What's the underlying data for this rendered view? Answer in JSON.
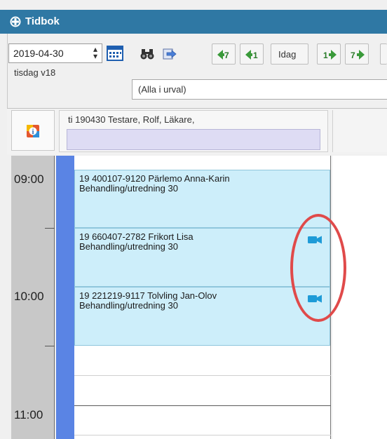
{
  "window": {
    "title": "Tidbok"
  },
  "toolbar": {
    "date_value": "2019-04-30",
    "weekday_label": "tisdag v18",
    "today_label": "Idag",
    "filter_value": "(Alla i urval)"
  },
  "header": {
    "column_label": "ti 190430 Testare, Rolf, Läkare,"
  },
  "timeline": {
    "hours": [
      "09:00",
      "10:00",
      "11:00"
    ]
  },
  "appointments": [
    {
      "line1": "19 400107-9120  Pärlemo Anna-Karin",
      "line2": "Behandling/utredning 30",
      "video": false
    },
    {
      "line1": "19 660407-2782  Frikort Lisa",
      "line2": "Behandling/utredning 30",
      "video": true
    },
    {
      "line1": "19 221219-9117  Tolvling Jan-Olov",
      "line2": "Behandling/utredning 30",
      "video": true
    }
  ],
  "colors": {
    "titlebar": "#2f78a4",
    "appointment": "#cdeefa",
    "resource_strip": "#5a84e4",
    "video_icon": "#1e9bd7",
    "annotation_circle": "#e04a4a",
    "column_band": "#dedcf4"
  }
}
